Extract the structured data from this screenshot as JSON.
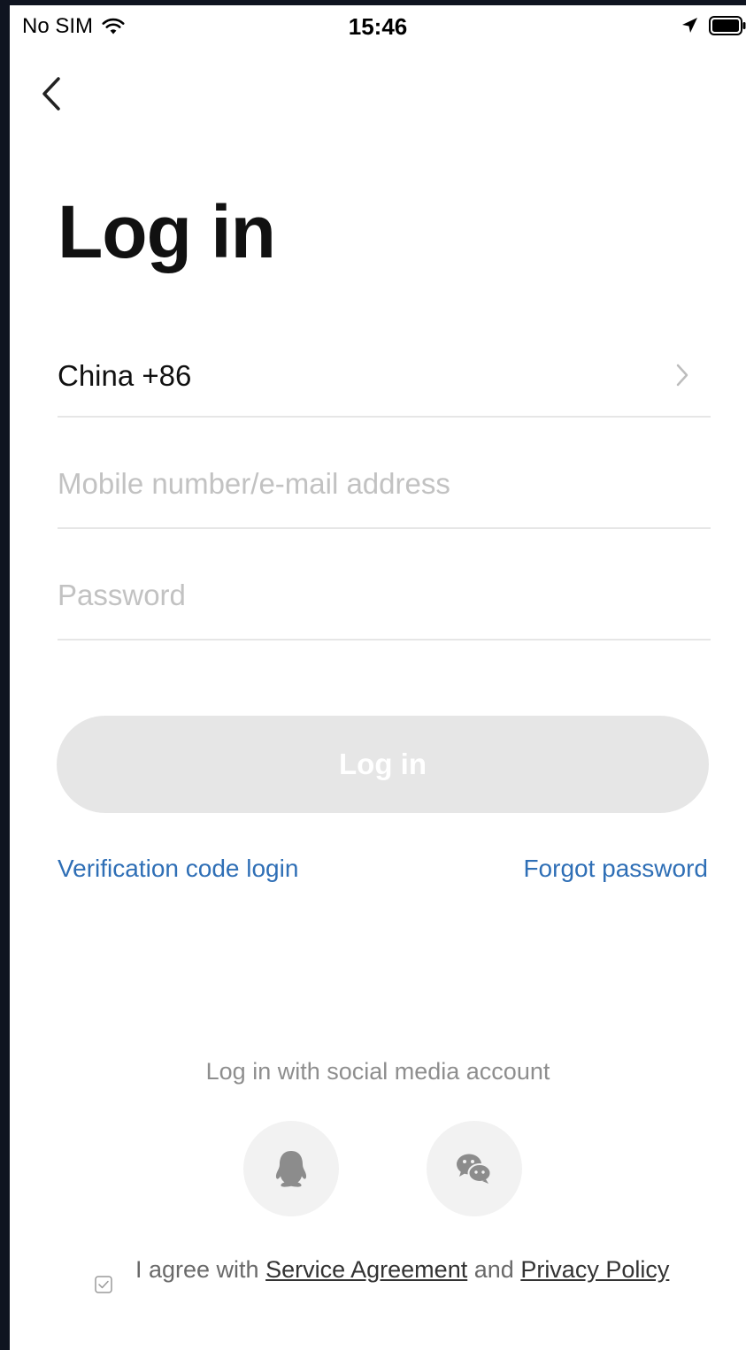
{
  "status_bar": {
    "carrier": "No SIM",
    "time": "15:46"
  },
  "title": "Log in",
  "form": {
    "country": "China +86",
    "account_placeholder": "Mobile number/e-mail address",
    "password_placeholder": "Password",
    "login_button": "Log in"
  },
  "links": {
    "verification": "Verification code login",
    "forgot": "Forgot password"
  },
  "social": {
    "caption": "Log in with social media account",
    "providers": [
      "qq-icon",
      "wechat-icon"
    ]
  },
  "agreement": {
    "prefix": "I agree with",
    "service_link": "Service Agreement",
    "conjunction": "and",
    "privacy_link": "Privacy Policy",
    "checked": true
  },
  "colors": {
    "link": "#2f6fb6",
    "button_disabled": "#e6e6e6",
    "placeholder": "#c2c2c2"
  }
}
